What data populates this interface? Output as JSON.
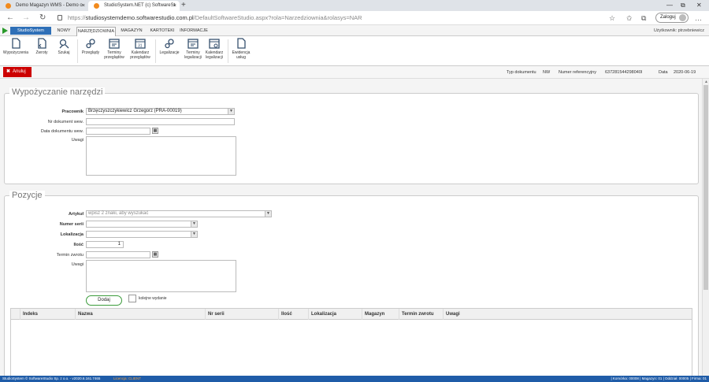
{
  "browser": {
    "tabs": [
      {
        "title": "Demo Magazyn WMS - Demo o",
        "close": "×"
      },
      {
        "title": "StudioSystem.NET (c) SoftwareSt",
        "close": "×"
      }
    ],
    "new_tab": "+",
    "url_prefix": "https://",
    "url_domain": "studiosystemdemo.softwarestudio.com.pl",
    "url_path": "/DefaultSoftwareStudio.aspx?rola=Narzedziownia&rolasys=NAR",
    "login_label": "Zaloguj",
    "minimize": "—",
    "maximize": "⧉",
    "close": "✕",
    "back": "←",
    "forward": "→",
    "reload": "↻",
    "star": "☆",
    "favorites": "✩",
    "collections": "⧉",
    "more": "…"
  },
  "app": {
    "brand": "StudioSystem",
    "menu": [
      "NOWY",
      "NARZĘDZIOWNIA",
      "MAGAZYN",
      "KARTOTEKI",
      "INFORMACJE"
    ],
    "user": "Użytkownik: ptrzebniewicz"
  },
  "ribbon": [
    {
      "label1": "Wypożyczenia",
      "label2": "",
      "icon": "document-icon"
    },
    {
      "label1": "Zwroty",
      "label2": "",
      "icon": "document-return-icon"
    },
    {
      "label1": "Szukaj",
      "label2": "",
      "icon": "search-tools-icon"
    },
    {
      "label1": "Przeglądy",
      "label2": "",
      "icon": "gears-icon"
    },
    {
      "label1": "Terminy",
      "label2": "przeglądów",
      "icon": "calendar-list-icon"
    },
    {
      "label1": "Kalendarz",
      "label2": "przeglądów",
      "icon": "calendar-icon"
    },
    {
      "label1": "Legalizacje",
      "label2": "",
      "icon": "gears-icon"
    },
    {
      "label1": "Terminy",
      "label2": "legalizacji",
      "icon": "calendar-list-icon"
    },
    {
      "label1": "Kalendarz",
      "label2": "legalizacji",
      "icon": "calendar-icon"
    },
    {
      "label1": "Ewidencja",
      "label2": "usług",
      "icon": "document-icon"
    }
  ],
  "toolbar": {
    "cancel": "Anuluj",
    "doc_type_label": "Typ dokumentu",
    "doc_type_value": "NW",
    "ref_label": "Numer referencyjny",
    "ref_value": "637281544298040l",
    "date_label": "Data",
    "date_value": "2020-06-19"
  },
  "form": {
    "title": "Wypożyczanie narzędzi",
    "employee_label": "Pracownik",
    "employee_value": "Brzęczyszczykiewicz Grzegorz (PRA-00019)",
    "extdoc_label": "Nr dokument wew.",
    "extdoc_value": "",
    "docdate_label": "Data dokumentu wew.",
    "docdate_value": "",
    "notes_label": "Uwagi"
  },
  "positions": {
    "title": "Pozycje",
    "article_label": "Artykuł",
    "article_placeholder": "wpisz 2 znaki, aby wyszukać",
    "serial_label": "Numer serii",
    "location_label": "Lokalizacja",
    "qty_label": "Ilość",
    "qty_value": "1",
    "return_label": "Termin zwrotu",
    "notes_label": "Uwagi",
    "add_button": "Dodaj",
    "next_issue_label": "kolejne wydanie",
    "columns": [
      "Indeks",
      "Nazwa",
      "Nr serii",
      "Ilość",
      "Lokalizacja",
      "Magazyn",
      "Termin zwrotu",
      "Uwagi"
    ]
  },
  "status": {
    "left": "StudioSystem © SoftwareStudio Sp. z o.o. - v2020.6.161.7465",
    "license": "Licencja: CLIENT",
    "right": "| Komórka: 00008 | Magazyn: 01 | Oddział: 00005 | Firma: 01"
  }
}
